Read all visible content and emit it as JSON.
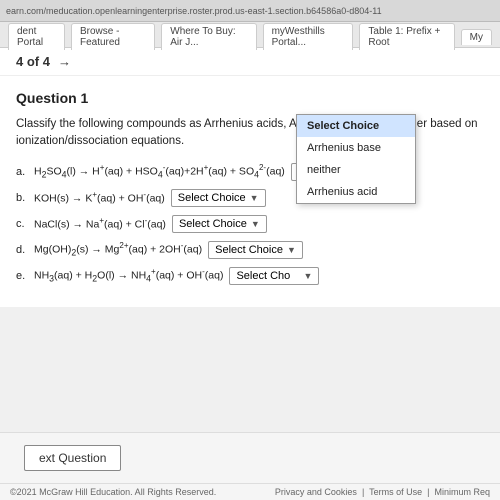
{
  "browser": {
    "url_text": "earn.com/meducation.openlearningenterprise.roster.prod.us-east-1.section.b64586a0-d804-11",
    "tabs": [
      {
        "label": "dent Portal"
      },
      {
        "label": "Browse - Featured"
      },
      {
        "label": "Where To Buy: Air J..."
      },
      {
        "label": "myWesthills Portal..."
      },
      {
        "label": "Table 1: Prefix + Root"
      },
      {
        "label": "My"
      }
    ]
  },
  "pagination": {
    "text": "4 of 4",
    "arrow": "→"
  },
  "question": {
    "title": "Question 1",
    "instructions": "Classify the following compounds as Arrhenius acids, Arrhenius bases, or neither based on ionization/dissociation equations.",
    "rows": [
      {
        "label": "a.",
        "equation": "H₂SO₄(l) → H⁺(aq) + HSO₄⁻(aq)+2H⁺(aq) + SO₄²⁻(aq)",
        "select_text": "Select Choice"
      },
      {
        "label": "b.",
        "equation": "KOH(s) → K⁺(aq) + OH⁻(aq)",
        "select_text": "Select Choice"
      },
      {
        "label": "c.",
        "equation": "NaCl(s) → Na⁺(aq) + Cl⁻(aq)",
        "select_text": "Select Choice"
      },
      {
        "label": "d.",
        "equation": "Mg(OH)₂(s) → Mg²⁺(aq) + 2OH⁻(aq)",
        "select_text": "Select Choice"
      },
      {
        "label": "e.",
        "equation": "NH₃(aq) + H₂O(l) → NH₄⁺(aq) + OH⁻(aq)",
        "select_text": "Select Cho"
      }
    ],
    "dropdown": {
      "options": [
        {
          "label": "Select Choice",
          "value": "select_choice"
        },
        {
          "label": "Arrhenius base",
          "value": "arrhenius_base"
        },
        {
          "label": "neither",
          "value": "neither"
        },
        {
          "label": "Arrhenius acid",
          "value": "arrhenius_acid"
        }
      ]
    }
  },
  "footer": {
    "next_button_label": "ext Question",
    "copyright": "©2021 McGraw Hill Education. All Rights Reserved.",
    "links": [
      "Privacy and Cookies",
      "Terms of Use",
      "Minimum Req"
    ]
  }
}
